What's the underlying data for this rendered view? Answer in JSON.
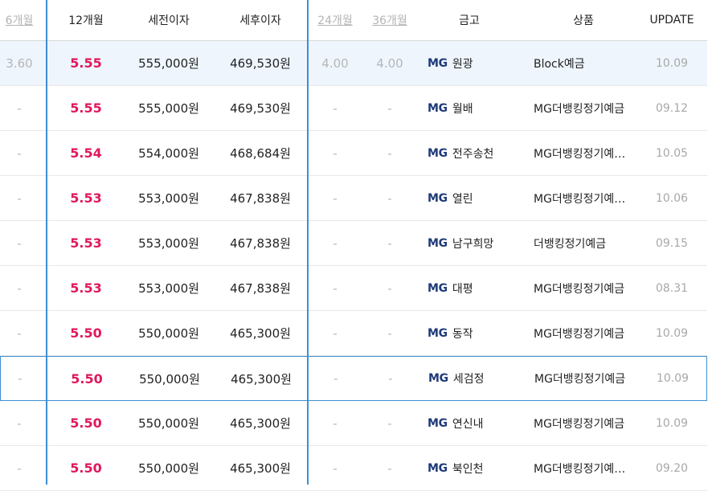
{
  "headers": {
    "m6": "6개월",
    "m12": "12개월",
    "pretax": "세전이자",
    "aftertax": "세후이자",
    "m24": "24개월",
    "m36": "36개월",
    "bank": "금고",
    "product": "상품",
    "update": "UPDATE"
  },
  "bank_logo": "MG",
  "rows": [
    {
      "m6": "3.60",
      "m12": "5.55",
      "pretax": "555,000원",
      "aftertax": "469,530원",
      "m24": "4.00",
      "m36": "4.00",
      "bank": "원광",
      "product": "Block예금",
      "update": "10.09"
    },
    {
      "m6": "-",
      "m12": "5.55",
      "pretax": "555,000원",
      "aftertax": "469,530원",
      "m24": "-",
      "m36": "-",
      "bank": "월배",
      "product": "MG더뱅킹정기예금",
      "update": "09.12"
    },
    {
      "m6": "-",
      "m12": "5.54",
      "pretax": "554,000원",
      "aftertax": "468,684원",
      "m24": "-",
      "m36": "-",
      "bank": "전주송천",
      "product": "MG더뱅킹정기예…",
      "update": "10.05"
    },
    {
      "m6": "-",
      "m12": "5.53",
      "pretax": "553,000원",
      "aftertax": "467,838원",
      "m24": "-",
      "m36": "-",
      "bank": "열린",
      "product": "MG더뱅킹정기예…",
      "update": "10.06"
    },
    {
      "m6": "-",
      "m12": "5.53",
      "pretax": "553,000원",
      "aftertax": "467,838원",
      "m24": "-",
      "m36": "-",
      "bank": "남구희망",
      "product": "더뱅킹정기예금",
      "update": "09.15"
    },
    {
      "m6": "-",
      "m12": "5.53",
      "pretax": "553,000원",
      "aftertax": "467,838원",
      "m24": "-",
      "m36": "-",
      "bank": "대평",
      "product": "MG더뱅킹정기예금",
      "update": "08.31"
    },
    {
      "m6": "-",
      "m12": "5.50",
      "pretax": "550,000원",
      "aftertax": "465,300원",
      "m24": "-",
      "m36": "-",
      "bank": "동작",
      "product": "MG더뱅킹정기예금",
      "update": "10.09"
    },
    {
      "m6": "-",
      "m12": "5.50",
      "pretax": "550,000원",
      "aftertax": "465,300원",
      "m24": "-",
      "m36": "-",
      "bank": "세검정",
      "product": "MG더뱅킹정기예금",
      "update": "10.09"
    },
    {
      "m6": "-",
      "m12": "5.50",
      "pretax": "550,000원",
      "aftertax": "465,300원",
      "m24": "-",
      "m36": "-",
      "bank": "연신내",
      "product": "MG더뱅킹정기예금",
      "update": "10.09"
    },
    {
      "m6": "-",
      "m12": "5.50",
      "pretax": "550,000원",
      "aftertax": "465,300원",
      "m24": "-",
      "m36": "-",
      "bank": "북인천",
      "product": "MG더뱅킹정기예…",
      "update": "09.20"
    }
  ]
}
